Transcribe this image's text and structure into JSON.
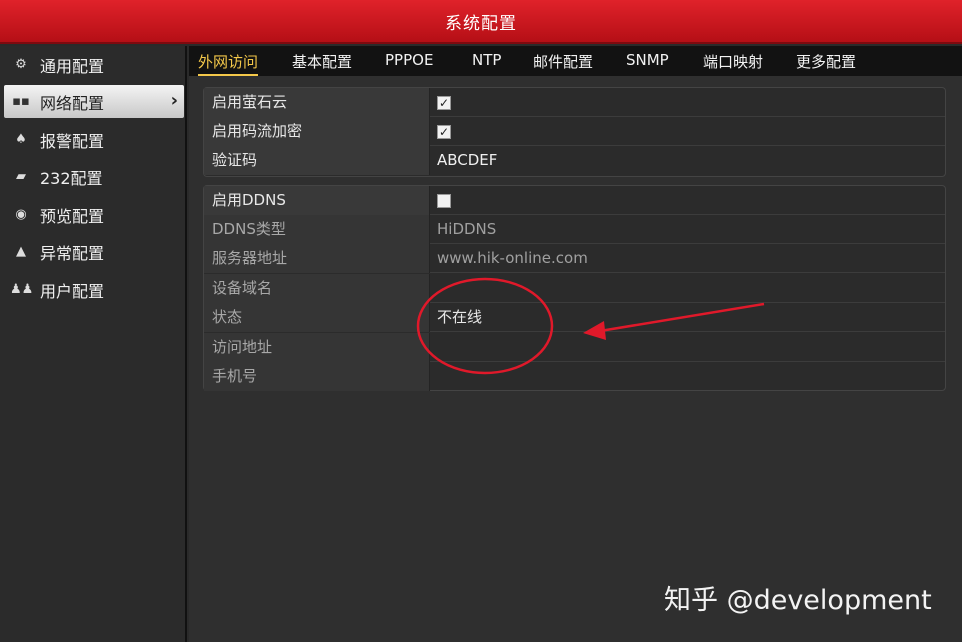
{
  "window": {
    "title": "系统配置"
  },
  "sidebar": {
    "items": [
      {
        "label": "通用配置",
        "icon": "gear-icon"
      },
      {
        "label": "网络配置",
        "icon": "network-icon",
        "active": true
      },
      {
        "label": "报警配置",
        "icon": "alarm-icon"
      },
      {
        "label": "232配置",
        "icon": "serial-port-icon"
      },
      {
        "label": "预览配置",
        "icon": "eye-icon"
      },
      {
        "label": "异常配置",
        "icon": "warning-icon"
      },
      {
        "label": "用户配置",
        "icon": "users-icon"
      }
    ]
  },
  "tabs": [
    {
      "label": "外网访问",
      "active": true
    },
    {
      "label": "基本配置"
    },
    {
      "label": "PPPOE"
    },
    {
      "label": "NTP"
    },
    {
      "label": "邮件配置"
    },
    {
      "label": "SNMP"
    },
    {
      "label": "端口映射"
    },
    {
      "label": "更多配置"
    }
  ],
  "ezviz": {
    "enable_label": "启用萤石云",
    "enable_checked": true,
    "encrypt_label": "启用码流加密",
    "encrypt_checked": true,
    "code_label": "验证码",
    "code_value": "ABCDEF"
  },
  "ddns": {
    "enable_label": "启用DDNS",
    "enable_checked": false,
    "type_label": "DDNS类型",
    "type_value": "HiDDNS",
    "server_label": "服务器地址",
    "server_value": "www.hik-online.com",
    "domain_label": "设备域名",
    "domain_value": "",
    "status_label": "状态",
    "status_value": "不在线",
    "access_label": "访问地址",
    "access_value": "",
    "phone_label": "手机号",
    "phone_value": ""
  },
  "watermark": "知乎 @development",
  "colors": {
    "title_bar": "#d11a21",
    "active_tab": "#f4c84a",
    "annotation": "#e0192a"
  }
}
